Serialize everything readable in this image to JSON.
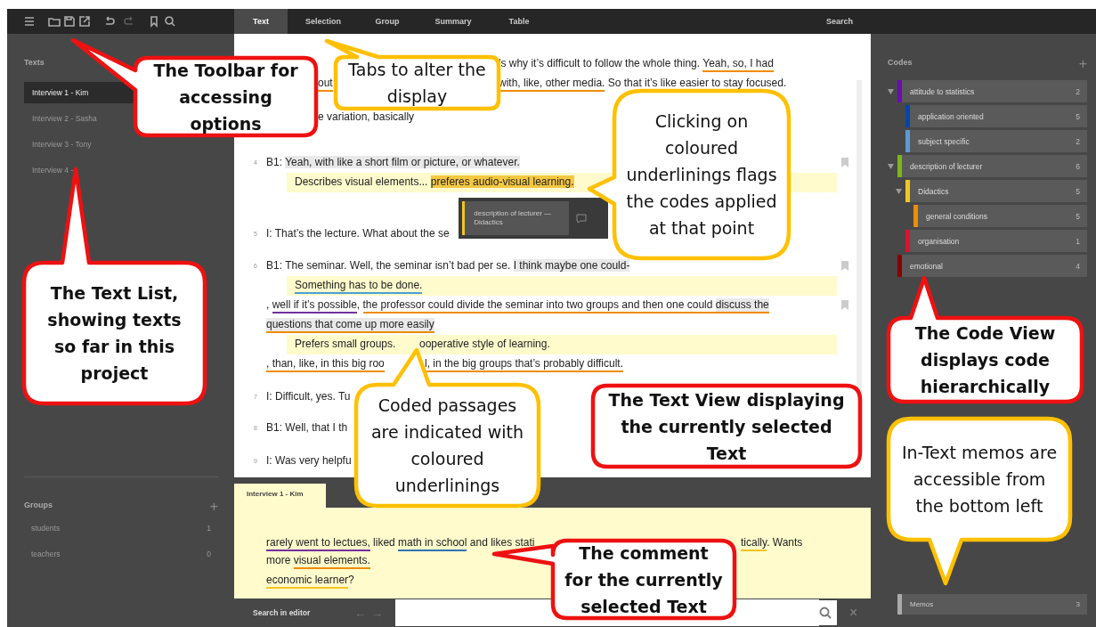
{
  "tabs": [
    {
      "label": "Text",
      "selected": true
    },
    {
      "label": "Selection",
      "selected": false
    },
    {
      "label": "Group",
      "selected": false
    },
    {
      "label": "Summary",
      "selected": false
    },
    {
      "label": "Table",
      "selected": false
    }
  ],
  "search_tab": "Search",
  "texts": {
    "title": "Texts",
    "items": [
      {
        "label": "Interview 1 - Kim",
        "selected": true
      },
      {
        "label": "Interview 2 - Sasha",
        "selected": false
      },
      {
        "label": "Interview 3 - Tony",
        "selected": false
      },
      {
        "label": "Interview 4 - ",
        "selected": false
      }
    ]
  },
  "groups": {
    "title": "Groups",
    "items": [
      {
        "label": "students",
        "count": "1"
      },
      {
        "label": "teachers",
        "count": "0"
      }
    ]
  },
  "text_view": {
    "paragraphs": [
      {
        "lines": [
          {
            "kind": "speech",
            "bookmark": false,
            "segments": [
              [
                {
                  "text": "’s why it’s difficult to follow the whole thing. "
                },
                {
                  "text": "Yeah, so, I had",
                  "color": "#f08c00"
                }
              ]
            ]
          },
          {
            "kind": "speech",
            "bookmark": false,
            "segments": [
              [
                {
                  "text": "out",
                  "color": "#f08c00"
                }
              ],
              [
                {
                  "text": "with, like, other media.",
                  "color": "#f08c00"
                },
                {
                  "text": " So that it’s like easier to stay focused."
                }
              ]
            ]
          }
        ]
      },
      {
        "lines": [
          {
            "kind": "speech",
            "bookmark": false,
            "segments": [
              [
                {
                  "text": "e variation, basically"
                }
              ]
            ]
          }
        ]
      },
      {
        "number": "4",
        "lines": [
          {
            "kind": "speech",
            "bookmark": true,
            "segments": [
              [
                {
                  "text": "B1: "
                },
                {
                  "text": "Yeah, with like a short film or picture, or whatever.",
                  "highlighted": true
                }
              ]
            ]
          },
          {
            "kind": "memo",
            "bookmark": false,
            "segments": [
              [
                {
                  "text": "Describes visual elements... "
                },
                {
                  "text": "preferes audio-visual learning.",
                  "active": true
                }
              ]
            ]
          }
        ]
      },
      {
        "number": "5",
        "lines": [
          {
            "kind": "speech",
            "bookmark": false,
            "segments": [
              [
                {
                  "text": "I: That’s the lecture. What about the se"
                }
              ]
            ]
          }
        ]
      },
      {
        "number": "6",
        "lines": [
          {
            "kind": "speech",
            "bookmark": true,
            "segments": [
              [
                {
                  "text": "B1: The seminar. Well, the seminar isn’t bad per se. "
                },
                {
                  "text": "I think maybe one could-",
                  "highlighted": true
                }
              ]
            ]
          },
          {
            "kind": "memo",
            "bookmark": false,
            "segments": [
              [
                {
                  "text": "Something has to be done.",
                  "color": "#4a9fd4"
                }
              ]
            ]
          },
          {
            "kind": "speech",
            "bookmark": true,
            "segments": [
              [
                {
                  "text": ", "
                },
                {
                  "text": "well if it’s possible",
                  "color": "#7030a0"
                },
                {
                  "text": ", "
                },
                {
                  "text": "the professor could divide the seminar into two groups and then one could ",
                  "color": "#f08c00"
                },
                {
                  "text": "discuss the",
                  "color": "#f08c00",
                  "highlighted": true
                }
              ]
            ]
          },
          {
            "kind": "speech",
            "bookmark": false,
            "segments": [
              [
                {
                  "text": "questions that come up more easily",
                  "color": "#f08c00",
                  "highlighted": true
                }
              ]
            ]
          },
          {
            "kind": "memo",
            "bookmark": false,
            "segments": [
              [
                {
                  "text": "Prefers small groups."
                }
              ],
              [
                {
                  "text": "ooperative style of learning."
                }
              ]
            ]
          },
          {
            "kind": "speech",
            "bookmark": false,
            "segments": [
              [
                {
                  "text": ", than, like, in this big roo",
                  "color": "#f08c00"
                }
              ],
              [
                {
                  "text": "l, in the big groups that’s probably difficult.",
                  "color": "#f08c00"
                }
              ]
            ]
          }
        ]
      },
      {
        "number": "7",
        "lines": [
          {
            "kind": "speech",
            "bookmark": false,
            "segments": [
              [
                {
                  "text": "I: Difficult, yes. Tu"
                }
              ]
            ]
          }
        ]
      },
      {
        "number": "8",
        "lines": [
          {
            "kind": "speech",
            "bookmark": false,
            "segments": [
              [
                {
                  "text": "B1: Well, that I th"
                }
              ]
            ]
          }
        ]
      },
      {
        "number": "9",
        "lines": [
          {
            "kind": "speech",
            "bookmark": false,
            "segments": [
              [
                {
                  "text": "I: Was very helpfu"
                }
              ]
            ]
          }
        ]
      }
    ]
  },
  "code_popup": {
    "label": "description of lecturer — Didactics",
    "color": "#f2c520"
  },
  "comment": {
    "tab": "Interview 1 - Kim",
    "lines": [
      {
        "segments": [
          [
            {
              "text": "rarely went to lectues,",
              "color": "#7030a0"
            },
            {
              "text": " liked "
            },
            {
              "text": "math in school",
              "color": "#2e75b6"
            },
            {
              "text": " and likes stati"
            }
          ],
          [
            {
              "text": "tically",
              "color": "#f2c520"
            },
            {
              "text": ". Wants"
            }
          ]
        ]
      },
      {
        "segments": [
          [
            {
              "text": "more "
            },
            {
              "text": "visual elements.",
              "color": "#f08c00"
            }
          ]
        ]
      },
      {
        "segments": [
          [
            {
              "text": "economic learner",
              "color": "#f2c520"
            },
            {
              "text": "?"
            }
          ]
        ]
      }
    ]
  },
  "search_editor": {
    "label": "Search in editor",
    "prev": "←",
    "next": "→",
    "close": "×"
  },
  "codes": {
    "title": "Codes",
    "add": "+",
    "items": [
      {
        "label": "attitude to statistics",
        "count": "2",
        "color": "#6a0dad",
        "expanded": true,
        "children": [
          {
            "label": "application oriented",
            "count": "5",
            "color": "#0047ab"
          },
          {
            "label": "subject specific",
            "count": "2",
            "color": "#5b9bd5"
          }
        ]
      },
      {
        "label": "description of lecturer",
        "count": "6",
        "color": "#7cb518",
        "expanded": true,
        "children": [
          {
            "label": "Didactics",
            "count": "5",
            "color": "#f2c520",
            "expanded": true,
            "children": [
              {
                "label": "general conditions",
                "count": "5",
                "color": "#f08c00"
              }
            ]
          },
          {
            "label": "organisation",
            "count": "1",
            "color": "#e0102f"
          }
        ]
      },
      {
        "label": "emotional",
        "count": "4",
        "color": "#8b0000"
      }
    ]
  },
  "memos": {
    "label": "Memos",
    "count": "3"
  },
  "groups_add": "+",
  "callouts": [
    {
      "kind": "heading",
      "text": "The Toolbar for accessing options"
    },
    {
      "kind": "note",
      "text": "Tabs to alter the display"
    },
    {
      "kind": "note",
      "text": "Clicking on coloured underlinings flags the codes applied at that point"
    },
    {
      "kind": "heading",
      "text": "The Text List, showing texts so far in this project"
    },
    {
      "kind": "note",
      "text": "Coded passages are indicated with coloured underlinings"
    },
    {
      "kind": "heading",
      "text": "The Text View displaying the currently selected Text"
    },
    {
      "kind": "heading",
      "text": "The Code View displays code hierarchically"
    },
    {
      "kind": "note",
      "text": "In-Text memos are accessible from the bottom left"
    },
    {
      "kind": "heading",
      "text": "The comment for the currently selected Text"
    }
  ]
}
